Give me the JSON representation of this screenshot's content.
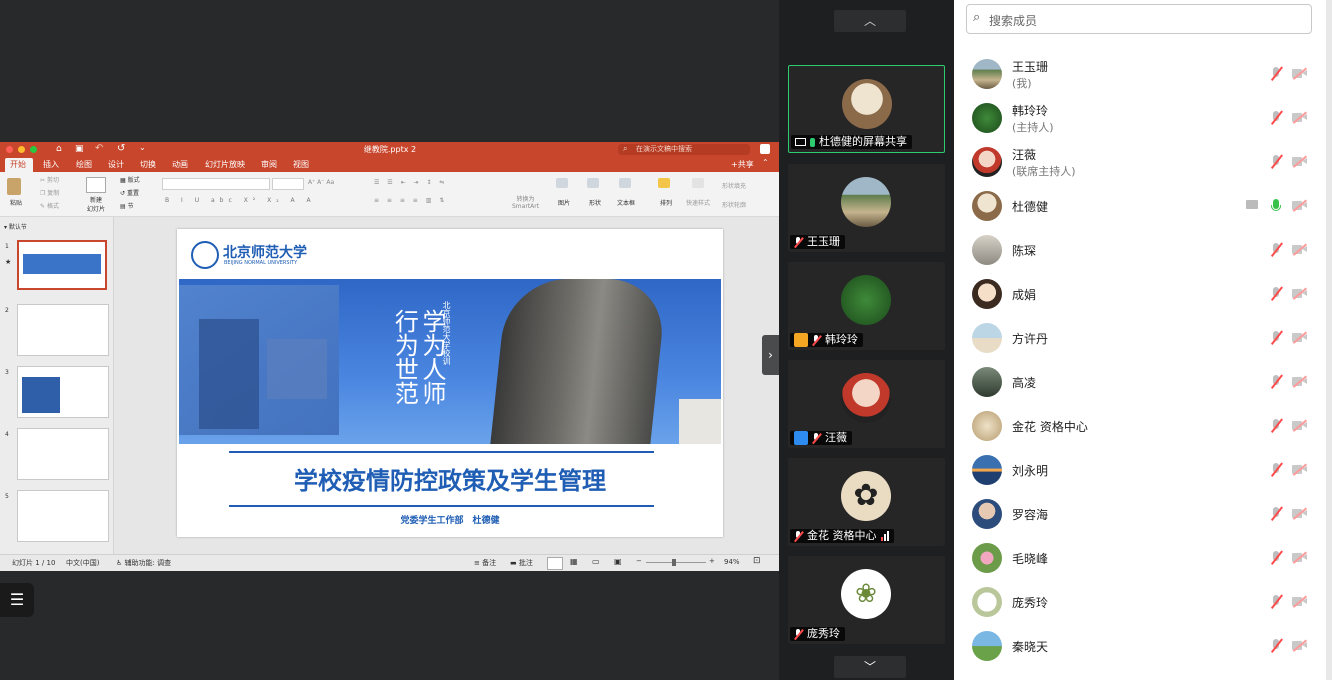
{
  "ppt": {
    "title": "继教院.pptx 2",
    "search_placeholder": "在演示文稿中搜索",
    "share_label": "共享",
    "tabs": [
      "开始",
      "插入",
      "绘图",
      "设计",
      "切换",
      "动画",
      "幻灯片放映",
      "审阅",
      "视图"
    ],
    "ribbon": {
      "paste": "粘贴",
      "cut": "剪切",
      "copy": "复制",
      "format": "格式",
      "new_slide": "新建\n幻灯片",
      "layout": "版式",
      "reset": "重置",
      "section": "节",
      "convert_smartart": "转换为\nSmartArt",
      "picture": "图片",
      "shape": "形状",
      "textbox": "文本框",
      "arrange": "排列",
      "quick_styles": "快速样式",
      "shape_fill": "形状填充",
      "shape_outline": "形状轮廓"
    },
    "section_label": "默认节",
    "slide_numbers": [
      "1",
      "2",
      "3",
      "4",
      "5"
    ],
    "slide": {
      "university_cn": "北京师范大学",
      "university_en": "BEIJING NORMAL UNIVERSITY",
      "motto": "学为人师 行为世范",
      "motto_note": "北京师范大学校训",
      "title": "学校疫情防控政策及学生管理",
      "subtitle": "党委学生工作部　杜德健"
    },
    "status": {
      "slide_position": "幻灯片 1 / 10",
      "language": "中文(中国)",
      "accessibility": "辅助功能: 调查",
      "notes": "备注",
      "comments": "批注",
      "zoom": "94%"
    }
  },
  "video_tiles": [
    {
      "name": "杜德健的屏幕共享",
      "active": true
    },
    {
      "name": "王玉珊"
    },
    {
      "name": "韩玲玲"
    },
    {
      "name": "汪薇"
    },
    {
      "name": "金花 资格中心"
    },
    {
      "name": "庞秀玲"
    }
  ],
  "participants": {
    "search_placeholder": "搜索成员",
    "list": [
      {
        "name": "王玉珊",
        "role": "(我)"
      },
      {
        "name": "韩玲玲",
        "role": "(主持人)"
      },
      {
        "name": "汪薇",
        "role": "(联席主持人)"
      },
      {
        "name": "杜德健",
        "role": ""
      },
      {
        "name": "陈琛",
        "role": ""
      },
      {
        "name": "成娟",
        "role": ""
      },
      {
        "name": "方许丹",
        "role": ""
      },
      {
        "name": "高凌",
        "role": ""
      },
      {
        "name": "金花 资格中心",
        "role": ""
      },
      {
        "name": "刘永明",
        "role": ""
      },
      {
        "name": "罗容海",
        "role": ""
      },
      {
        "name": "毛晓峰",
        "role": ""
      },
      {
        "name": "庞秀玲",
        "role": ""
      },
      {
        "name": "秦晓天",
        "role": ""
      }
    ]
  },
  "colors": {
    "ppt_accent": "#c8462c",
    "slide_title": "#1f5eb4",
    "active_border": "#2ecc71",
    "muted_red": "#ff4b4b"
  }
}
